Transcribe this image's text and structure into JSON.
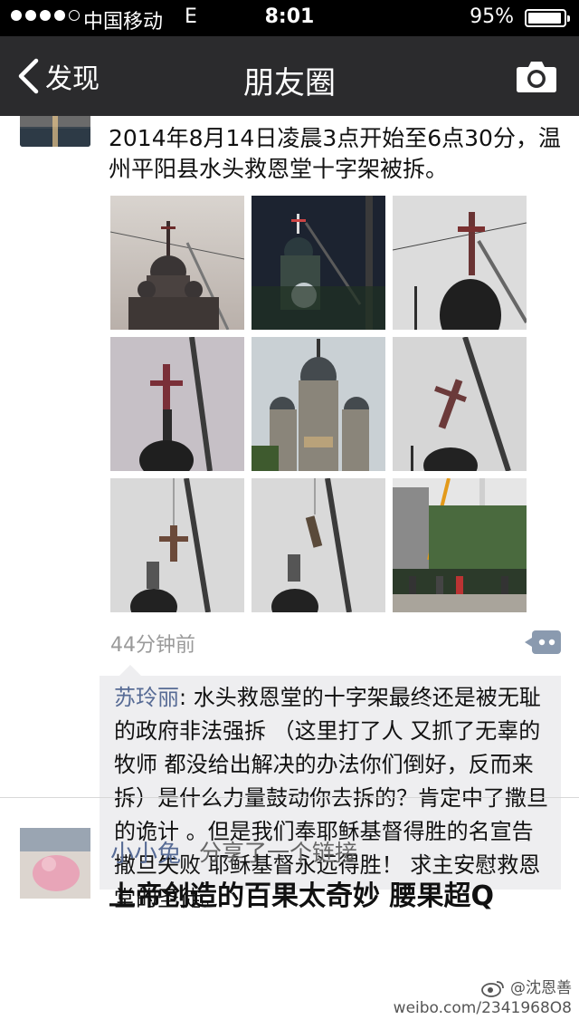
{
  "status_bar": {
    "carrier": "中国移动",
    "network": "E",
    "time": "8:01",
    "battery_percent": "95%",
    "battery_level": 0.95
  },
  "nav": {
    "back_label": "发现",
    "title": "朋友圈"
  },
  "post1": {
    "text": "2014年8月14日凌晨3点开始至6点30分，温州平阳县水头救恩堂十字架被拆。",
    "timestamp": "44分钟前",
    "photo_count": 9,
    "comment": {
      "author": "苏玲丽",
      "separator": ": ",
      "text": "水头救恩堂的十字架最终还是被无耻的政府非法强拆 （这里打了人  又抓了无辜的牧师 都没给出解决的办法你们倒好，反而来拆）是什么力量鼓动你去拆的？肯定中了撒旦的诡计 。但是我们奉耶稣基督得胜的名宣告 撒旦失败 耶稣基督永远得胜！ 求主安慰救恩堂的圣徒。"
    }
  },
  "post2": {
    "user": "小小兔",
    "action": "分享了一个链接",
    "link_title": "上帝创造的百果太奇妙 腰果超Q"
  },
  "watermark": {
    "handle": "@沈恩善",
    "url": "weibo.com/2341968O8"
  },
  "colors": {
    "nav_bg": "#2b2b2d",
    "status_bg": "#000000",
    "link_blue": "#576b95",
    "comment_bg": "#eeeef0"
  }
}
